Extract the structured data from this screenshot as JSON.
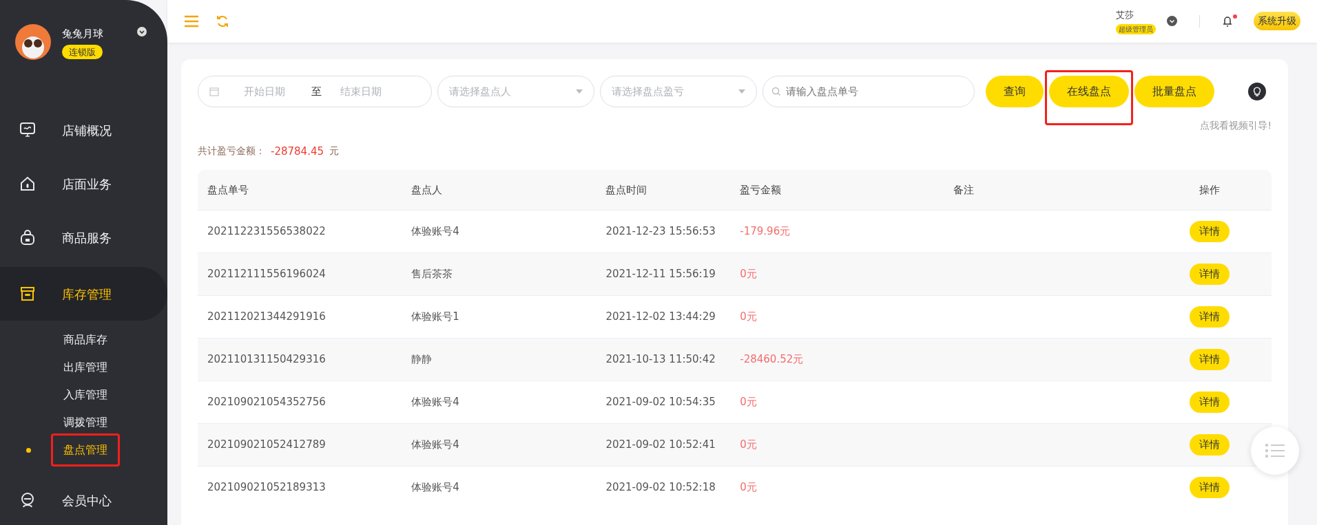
{
  "sidebar": {
    "user": {
      "name": "兔兔月球",
      "edition": "连锁版"
    },
    "menu": [
      {
        "label": "店铺概况",
        "selected": false
      },
      {
        "label": "店面业务",
        "selected": false
      },
      {
        "label": "商品服务",
        "selected": false
      },
      {
        "label": "库存管理",
        "selected": true,
        "expanded": true,
        "children": [
          {
            "label": "商品库存",
            "selected": false,
            "highlighted": false
          },
          {
            "label": "出库管理",
            "selected": false,
            "highlighted": false
          },
          {
            "label": "入库管理",
            "selected": false,
            "highlighted": false
          },
          {
            "label": "调拨管理",
            "selected": false,
            "highlighted": false
          },
          {
            "label": "盘点管理",
            "selected": true,
            "highlighted": true
          }
        ]
      },
      {
        "label": "会员中心",
        "selected": false
      }
    ]
  },
  "topbar": {
    "user_name": "艾莎",
    "role": "超级管理员",
    "notifications_unread": true,
    "upgrade_button": "系统升级"
  },
  "filters": {
    "start_date": {
      "placeholder": "开始日期"
    },
    "range_separator": "至",
    "end_date": {
      "placeholder": "结束日期"
    },
    "person_select": {
      "placeholder": "请选择盘点人"
    },
    "profit_select": {
      "placeholder": "请选择盘点盈亏"
    },
    "search": {
      "placeholder": "请输入盘点单号"
    },
    "buttons": [
      {
        "label": "查询",
        "highlighted": false
      },
      {
        "label": "在线盘点",
        "highlighted": true
      },
      {
        "label": "批量盘点",
        "highlighted": false
      }
    ]
  },
  "video_guide_link": "点我看视频引导!",
  "summary": {
    "label": "共计盈亏金额：",
    "amount": "-28784.45",
    "unit": "元"
  },
  "table": {
    "columns": [
      "盘点单号",
      "盘点人",
      "盘点时间",
      "盈亏金额",
      "备注",
      "操作"
    ],
    "rows": [
      {
        "id": "202112231556538022",
        "person": "体验账号4",
        "time": "2021-12-23 15:56:53",
        "amount": "-179.96元",
        "action": "详情"
      },
      {
        "id": "202112111556196024",
        "person": "售后茶茶",
        "time": "2021-12-11 15:56:19",
        "amount": "0元",
        "action": "详情"
      },
      {
        "id": "202112021344291916",
        "person": "体验账号1",
        "time": "2021-12-02 13:44:29",
        "amount": "0元",
        "action": "详情"
      },
      {
        "id": "202110131150429316",
        "person": "静静",
        "time": "2021-10-13 11:50:42",
        "amount": "-28460.52元",
        "action": "详情"
      },
      {
        "id": "202109021054352756",
        "person": "体验账号4",
        "time": "2021-09-02 10:54:35",
        "amount": "0元",
        "action": "详情"
      },
      {
        "id": "202109021052412789",
        "person": "体验账号4",
        "time": "2021-09-02 10:52:41",
        "amount": "0元",
        "action": "详情"
      },
      {
        "id": "202109021052189313",
        "person": "体验账号4",
        "time": "2021-09-02 10:52:18",
        "amount": "0元",
        "action": "详情"
      }
    ]
  }
}
